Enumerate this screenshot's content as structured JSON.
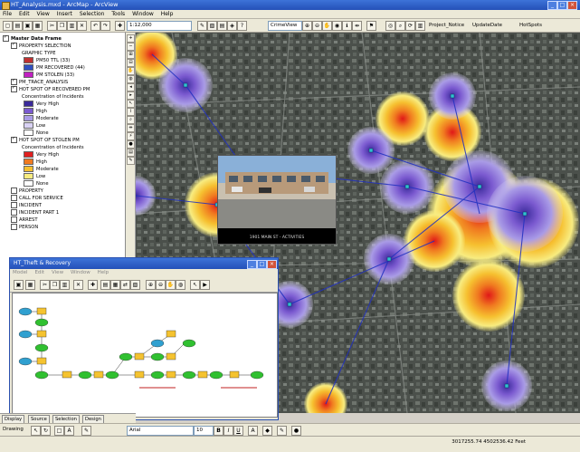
{
  "window": {
    "title": "HT_Analysis.mxd - ArcMap - ArcView",
    "minimize": "_",
    "maximize": "□",
    "close": "×"
  },
  "menu": [
    "File",
    "Edit",
    "View",
    "Insert",
    "Selection",
    "Tools",
    "Window",
    "Help"
  ],
  "toolbar": {
    "scale": "1:12,000",
    "view_combo": "CrimeView",
    "project_label": "Project_Notice",
    "update_label": "UpdateDate",
    "hotspots_label": "HotSpots"
  },
  "toc": {
    "root": "Master Data Frame",
    "groups": [
      {
        "label": "PROPERTY SELECTION",
        "checked": true,
        "items": [
          {
            "label": "GRAPHIC TYPE",
            "color": ""
          },
          {
            "label": "PM50 TTL (33)",
            "color": "#c03030"
          },
          {
            "label": "PM RECOVERED (44)",
            "color": "#3050c0"
          },
          {
            "label": "PM STOLEN (33)",
            "color": "#c020c0"
          }
        ]
      },
      {
        "label": "PM_TRACE_ANALYSIS",
        "checked": true,
        "items": []
      },
      {
        "label": "HOT SPOT OF RECOVERED PM",
        "checked": true,
        "items": [
          {
            "label": "Concentration of Incidents",
            "color": ""
          },
          {
            "label": "Very High",
            "color": "#3a2a9a"
          },
          {
            "label": "High",
            "color": "#7b5ad0"
          },
          {
            "label": "Moderate",
            "color": "#a99be6"
          },
          {
            "label": "Low",
            "color": "#d9d2f4"
          },
          {
            "label": "None",
            "color": "#ffffff"
          }
        ]
      },
      {
        "label": "HOT SPOT OF STOLEN PM",
        "checked": true,
        "items": [
          {
            "label": "Concentration of Incidents",
            "color": ""
          },
          {
            "label": "Very High",
            "color": "#e02020"
          },
          {
            "label": "High",
            "color": "#f07a20"
          },
          {
            "label": "Moderate",
            "color": "#f6c030"
          },
          {
            "label": "Low",
            "color": "#f8ec80"
          },
          {
            "label": "None",
            "color": "#ffffff"
          }
        ]
      },
      {
        "label": "PROPERTY",
        "checked": false,
        "items": []
      },
      {
        "label": "CALL FOR SERVICE",
        "checked": false,
        "items": []
      },
      {
        "label": "INCIDENT",
        "checked": false,
        "items": []
      },
      {
        "label": "INCIDENT PART 1",
        "checked": false,
        "items": []
      },
      {
        "label": "ARREST",
        "checked": false,
        "items": []
      },
      {
        "label": "PERSON",
        "checked": false,
        "items": []
      }
    ]
  },
  "photo": {
    "caption": "1901 MAIN ST - ACTIVITIES"
  },
  "model_builder": {
    "title": "HT_Theft & Recovery",
    "menu": [
      "Model",
      "Edit",
      "View",
      "Window",
      "Help"
    ]
  },
  "tabs": [
    "Display",
    "Source",
    "Selection",
    "Design"
  ],
  "drawbar": {
    "drawing": "Drawing",
    "font": "Arial",
    "size": "10"
  },
  "status": {
    "coords": "3017255.74  4502536.42 Feet"
  },
  "colors": {
    "map_background": "#4d524d",
    "hot_stolen": "#e02020",
    "hot_recovered": "#3a2a9a",
    "accent_title": "#2450b8"
  },
  "icons": [
    "new-icon",
    "open-icon",
    "save-icon",
    "print-icon",
    "zoom-in-icon",
    "zoom-out-icon",
    "pan-icon",
    "identify-icon",
    "select-icon",
    "measure-icon"
  ]
}
